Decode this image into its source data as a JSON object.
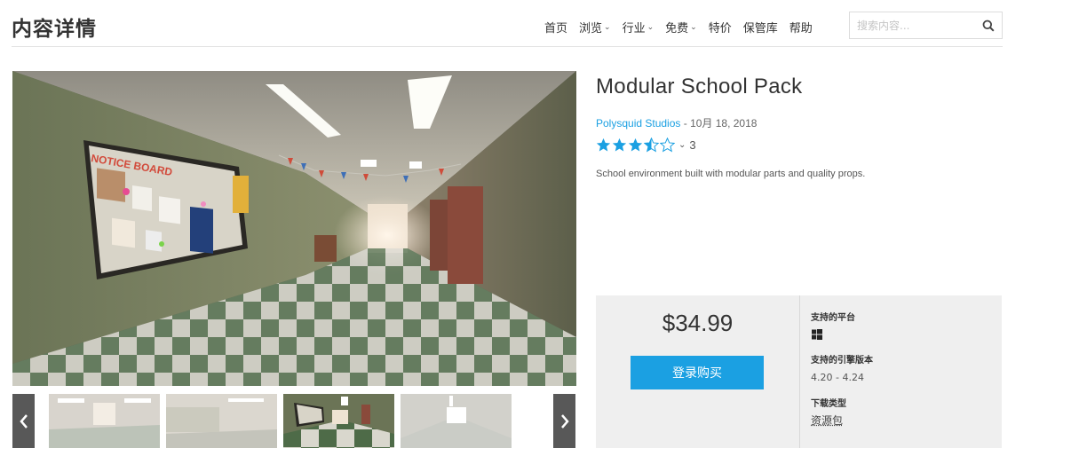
{
  "header": {
    "title": "内容详情",
    "nav": [
      {
        "label": "首页",
        "dropdown": false
      },
      {
        "label": "浏览",
        "dropdown": true
      },
      {
        "label": "行业",
        "dropdown": true
      },
      {
        "label": "免费",
        "dropdown": true
      },
      {
        "label": "特价",
        "dropdown": false
      },
      {
        "label": "保管库",
        "dropdown": false
      },
      {
        "label": "帮助",
        "dropdown": false
      }
    ],
    "search": {
      "placeholder": "搜索内容...",
      "value": "",
      "icon": "search-icon"
    }
  },
  "gallery": {
    "main_image_text": "NOTICE BOARD",
    "prev_icon": "chevron-left-icon",
    "next_icon": "chevron-right-icon",
    "thumbnails": [
      {
        "name": "hallway-view-1",
        "active": false
      },
      {
        "name": "hallway-view-2",
        "active": false
      },
      {
        "name": "hallway-view-3",
        "active": true
      },
      {
        "name": "hallway-view-4",
        "active": false
      }
    ]
  },
  "product": {
    "title": "Modular School Pack",
    "publisher": "Polysquid Studios",
    "date_sep": " - ",
    "date": "10月 18, 2018",
    "rating": 3.5,
    "rating_count": "3",
    "description": "School environment built with modular parts and quality props."
  },
  "purchase": {
    "price": "$34.99",
    "button_label": "登录购买",
    "platform_label": "支持的平台",
    "platform_icon": "windows-icon",
    "engine_label": "支持的引擎版本",
    "engine_value": "4.20 - 4.24",
    "download_label": "下载类型",
    "download_value": "资源包"
  },
  "colors": {
    "accent": "#1ba0e2",
    "star": "#1ba0e2",
    "panel": "#efefef",
    "thumb_nav": "#585858"
  }
}
